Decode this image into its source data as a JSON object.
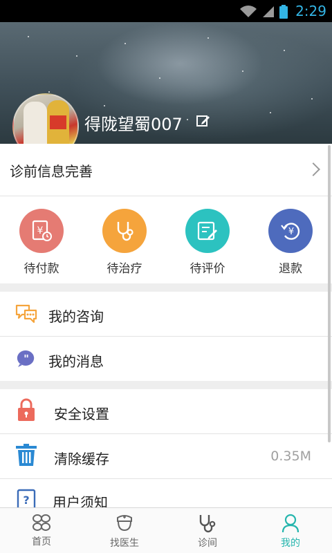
{
  "status_bar": {
    "time": "2:29"
  },
  "profile": {
    "username": "得陇望蜀007"
  },
  "pre_diagnosis": {
    "label": "诊前信息完善"
  },
  "orders": [
    {
      "label": "待付款",
      "icon": "yen-receipt-icon",
      "color": "#e57b73"
    },
    {
      "label": "待治疗",
      "icon": "stethoscope-icon",
      "color": "#f5a43c"
    },
    {
      "label": "待评价",
      "icon": "edit-note-icon",
      "color": "#2cc2c0"
    },
    {
      "label": "退款",
      "icon": "refund-icon",
      "color": "#4e6bbd"
    }
  ],
  "menu_group1": [
    {
      "label": "我的咨询",
      "icon": "chat-bubbles-icon",
      "color": "#f5a43c"
    },
    {
      "label": "我的消息",
      "icon": "message-quote-icon",
      "color": "#6a6fc4"
    }
  ],
  "menu_group2": [
    {
      "label": "安全设置",
      "icon": "lock-icon",
      "color": "#ec6a5c"
    },
    {
      "label": "清除缓存",
      "icon": "trash-icon",
      "color": "#2a89d3",
      "value": "0.35M"
    },
    {
      "label": "用户须知",
      "icon": "help-icon",
      "color": "#3a6bb8"
    }
  ],
  "tabs": [
    {
      "label": "首页",
      "icon": "home-grid-icon",
      "active": false
    },
    {
      "label": "找医生",
      "icon": "doctor-icon",
      "active": false
    },
    {
      "label": "诊间",
      "icon": "stethoscope-tab-icon",
      "active": false
    },
    {
      "label": "我的",
      "icon": "person-icon",
      "active": true
    }
  ],
  "colors": {
    "accent": "#25b5ad",
    "status_time": "#33b5e5"
  }
}
